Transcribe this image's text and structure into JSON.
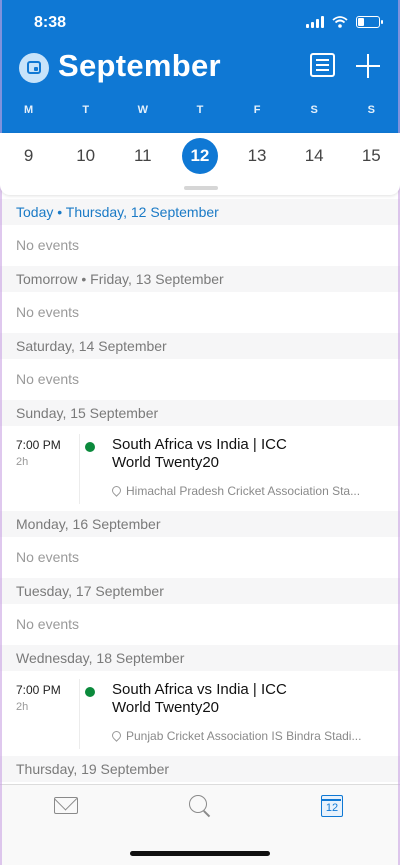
{
  "status_bar": {
    "time": "8:38",
    "battery_level": 0.3
  },
  "header": {
    "month": "September",
    "weekdays": [
      "M",
      "T",
      "W",
      "T",
      "F",
      "S",
      "S"
    ],
    "dates": [
      "9",
      "10",
      "11",
      "12",
      "13",
      "14",
      "15"
    ],
    "selected_date": "12",
    "accent_color": "#0f78d4"
  },
  "agenda": {
    "no_events_label": "No events",
    "days": [
      {
        "label": "Today • Thursday, 12 September"
      },
      {
        "label": "Tomorrow • Friday, 13 September"
      },
      {
        "label": "Saturday, 14 September"
      },
      {
        "label": "Sunday, 15 September"
      },
      {
        "label": "Monday, 16 September"
      },
      {
        "label": "Tuesday, 17 September"
      },
      {
        "label": "Wednesday, 18 September"
      },
      {
        "label": "Thursday, 19 September"
      }
    ],
    "events": [
      {
        "time": "7:00 PM",
        "duration": "2h",
        "title": "South Africa vs India | ICC World Twenty20",
        "location": "Himachal Pradesh Cricket Association Sta...",
        "color": "#0b8a3c"
      },
      {
        "time": "7:00 PM",
        "duration": "2h",
        "title": "South Africa vs India | ICC World Twenty20",
        "location": "Punjab Cricket Association IS Bindra Stadi...",
        "color": "#0b8a3c"
      }
    ]
  },
  "tabbar": {
    "icons": [
      "mail-icon",
      "search-icon",
      "calendar-icon"
    ],
    "calendar_icon_date": "12"
  }
}
